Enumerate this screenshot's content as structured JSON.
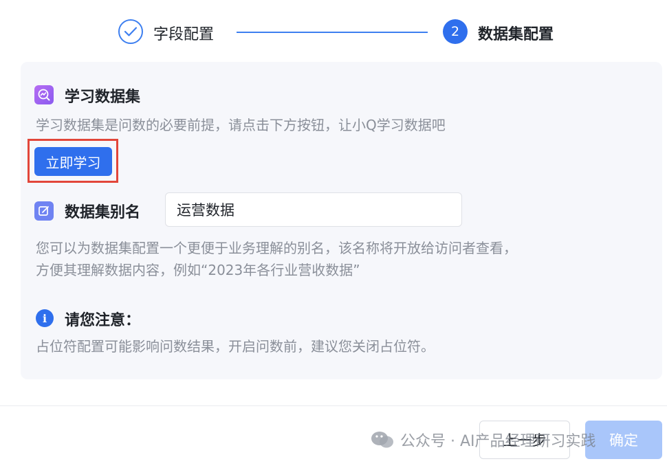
{
  "stepper": {
    "steps": [
      {
        "label": "字段配置",
        "status": "completed",
        "icon": "check-icon"
      },
      {
        "label": "数据集配置",
        "number": "2",
        "status": "active"
      }
    ]
  },
  "learn": {
    "title": "学习数据集",
    "icon": "learn-chart-icon",
    "description": "学习数据集是问数的必要前提，请点击下方按钮，让小Q学习数据吧",
    "button_label": "立即学习"
  },
  "alias": {
    "title": "数据集别名",
    "icon": "edit-icon",
    "value": "运营数据",
    "description_line1": "您可以为数据集配置一个更便于业务理解的别名，该名称将开放给访问者查看，",
    "description_line2": "方便其理解数据内容，例如“2023年各行业营收数据”"
  },
  "notice": {
    "title": "请您注意：",
    "icon": "info-icon",
    "icon_glyph": "i",
    "description": "占位符配置可能影响问数结果，开启问数前，建议您关闭占位符。"
  },
  "footer": {
    "prev_label": "上一步",
    "confirm_label": "确定"
  },
  "watermark": {
    "text": "公众号 · AI产品经理研习实践"
  },
  "colors": {
    "primary": "#2f6fed",
    "highlight_border": "#e2463a",
    "card_bg": "#f6f7fb"
  }
}
